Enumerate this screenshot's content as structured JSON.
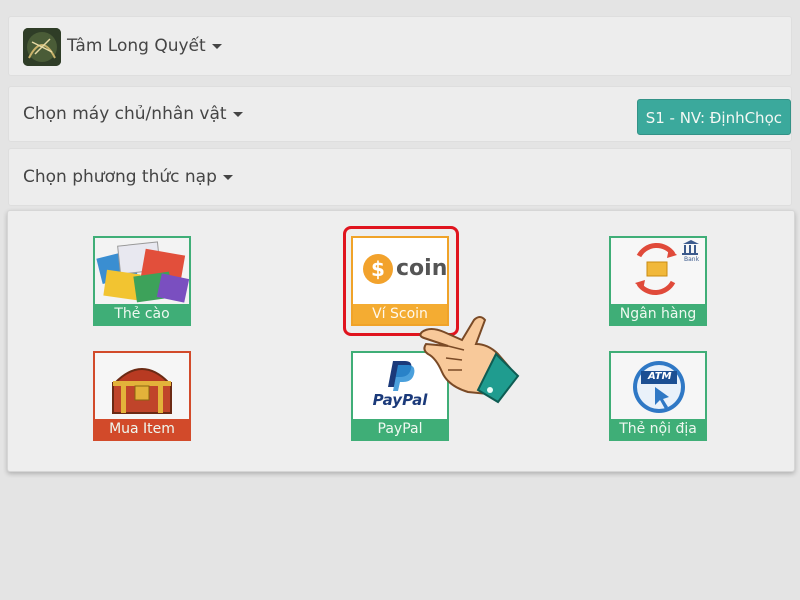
{
  "game": {
    "name": "Tâm Long Quyết",
    "logo_text": "Tâm Long Quyết"
  },
  "server": {
    "label": "Chọn máy chủ/nhân vật",
    "selected": "S1 - NV: ĐịnhChọc"
  },
  "method": {
    "label": "Chọn phương thức nạp"
  },
  "payment_methods": [
    {
      "label": "Thẻ cào",
      "icon": "phone-card-icon"
    },
    {
      "label": "Ví Scoin",
      "icon": "scoin-icon",
      "art_text": "coin"
    },
    {
      "label": "Ngân hàng",
      "icon": "bank-icon",
      "art_text": "Bank"
    },
    {
      "label": "Mua Item",
      "icon": "treasure-chest-icon"
    },
    {
      "label": "PayPal",
      "icon": "paypal-icon",
      "art_text": "PayPal"
    },
    {
      "label": "Thẻ nội địa",
      "icon": "atm-card-icon",
      "art_text": "ATM"
    }
  ],
  "colors": {
    "accent": "#3ba99c",
    "tile_green": "#3fae77",
    "tile_red": "#d24a2a",
    "tile_orange": "#f4ac32",
    "highlight": "#e0141e"
  }
}
